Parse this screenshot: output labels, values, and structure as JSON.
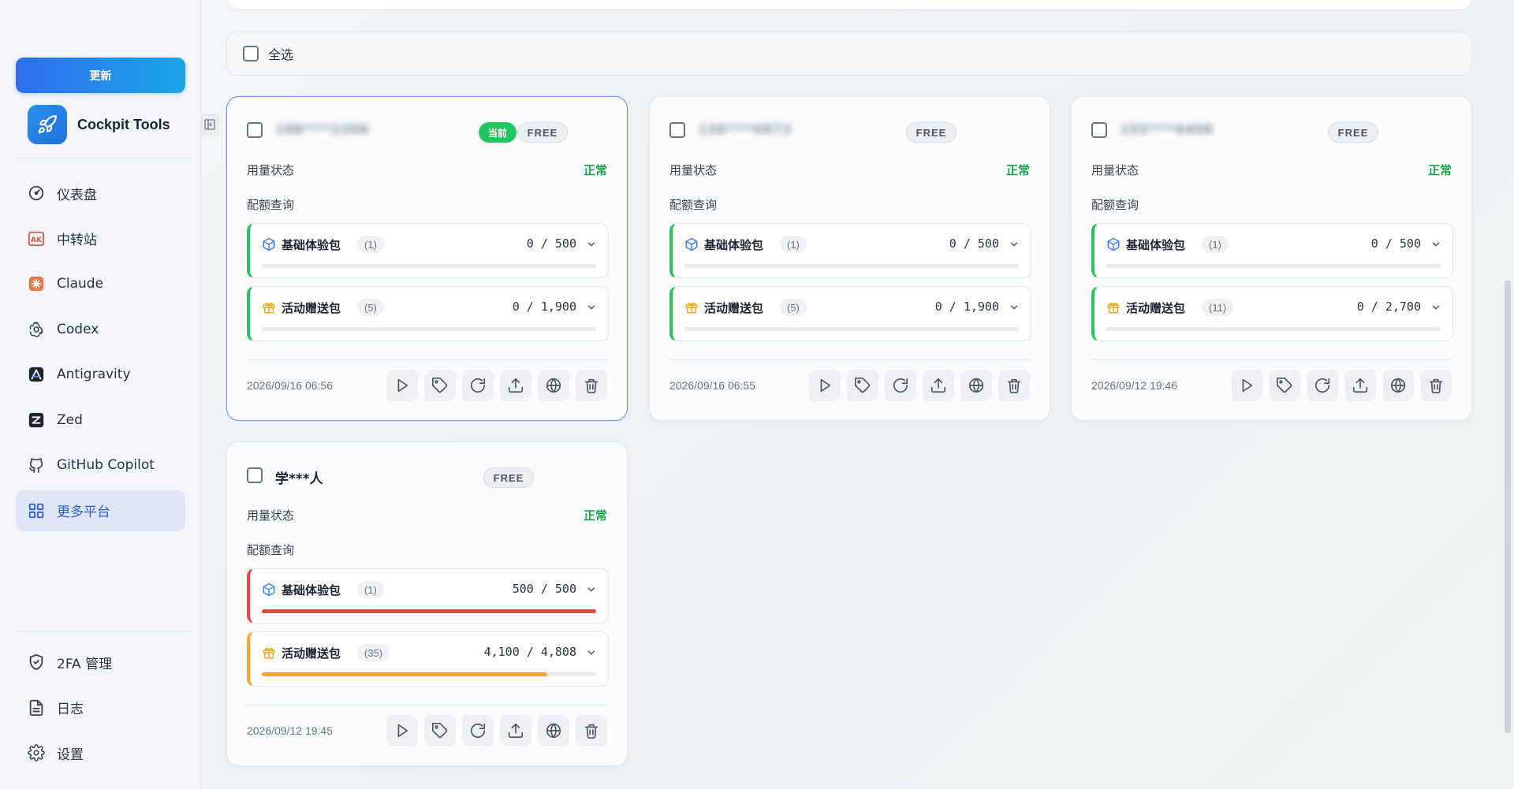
{
  "sidebar": {
    "update_label": "更新",
    "brand": "Cockpit Tools",
    "nav": [
      {
        "label": "仪表盘",
        "icon": "gauge-icon"
      },
      {
        "label": "中转站",
        "icon": "ak-icon"
      },
      {
        "label": "Claude",
        "icon": "claude-icon"
      },
      {
        "label": "Codex",
        "icon": "openai-icon"
      },
      {
        "label": "Antigravity",
        "icon": "antigravity-icon"
      },
      {
        "label": "Zed",
        "icon": "zed-icon"
      },
      {
        "label": "GitHub Copilot",
        "icon": "copilot-icon"
      },
      {
        "label": "更多平台",
        "icon": "grid-icon",
        "active": true
      }
    ],
    "bottom_nav": [
      {
        "label": "2FA 管理",
        "icon": "shield-check-icon"
      },
      {
        "label": "日志",
        "icon": "document-icon"
      },
      {
        "label": "设置",
        "icon": "gear-icon"
      }
    ]
  },
  "main": {
    "select_all_label": "全选",
    "current_badge": "当前",
    "free_badge": "FREE",
    "usage_status_label": "用量状态",
    "usage_status_value": "正常",
    "quota_label": "配额查询",
    "cards": [
      {
        "account": "188****2309",
        "current": true,
        "packages": [
          {
            "name": "基础体验包",
            "count": "(1)",
            "usage": "0 / 500",
            "fraction": 0,
            "color": "#22c55e",
            "kind": "cube"
          },
          {
            "name": "活动赠送包",
            "count": "(5)",
            "usage": "0 / 1,900",
            "fraction": 0,
            "color": "#22c55e",
            "kind": "gift"
          }
        ],
        "date": "2026/09/16 06:56"
      },
      {
        "account": "136****6873",
        "current": false,
        "packages": [
          {
            "name": "基础体验包",
            "count": "(1)",
            "usage": "0 / 500",
            "fraction": 0,
            "color": "#22c55e",
            "kind": "cube"
          },
          {
            "name": "活动赠送包",
            "count": "(5)",
            "usage": "0 / 1,900",
            "fraction": 0,
            "color": "#22c55e",
            "kind": "gift"
          }
        ],
        "date": "2026/09/16 06:55"
      },
      {
        "account": "155****6498",
        "current": false,
        "packages": [
          {
            "name": "基础体验包",
            "count": "(1)",
            "usage": "0 / 500",
            "fraction": 0,
            "color": "#22c55e",
            "kind": "cube"
          },
          {
            "name": "活动赠送包",
            "count": "(11)",
            "usage": "0 / 2,700",
            "fraction": 0,
            "color": "#22c55e",
            "kind": "gift"
          }
        ],
        "date": "2026/09/12 19:46"
      },
      {
        "account": "学***人",
        "current": false,
        "packages": [
          {
            "name": "基础体验包",
            "count": "(1)",
            "usage": "500 / 500",
            "fraction": 1.0,
            "color": "#ef4444",
            "kind": "cube"
          },
          {
            "name": "活动赠送包",
            "count": "(35)",
            "usage": "4,100 / 4,808",
            "fraction": 0.853,
            "color": "#f5a623",
            "kind": "gift"
          }
        ],
        "date": "2026/09/12 19:45"
      }
    ],
    "actions": [
      "play-icon",
      "tag-icon",
      "refresh-icon",
      "upload-icon",
      "globe-icon",
      "trash-icon"
    ]
  }
}
